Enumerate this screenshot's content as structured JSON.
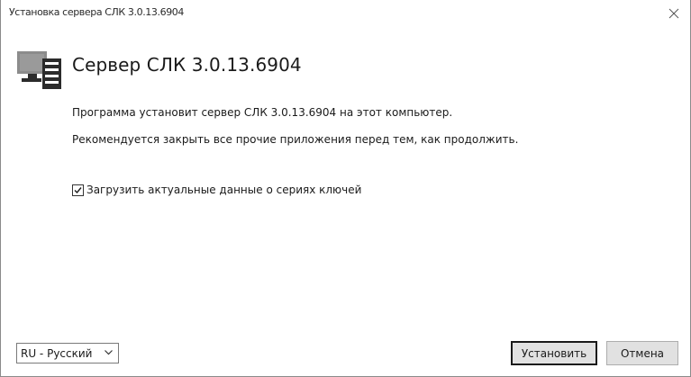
{
  "window": {
    "title": "Установка сервера СЛК 3.0.13.6904"
  },
  "header": {
    "title": "Сервер СЛК 3.0.13.6904",
    "icon": "server-computer-icon"
  },
  "body": {
    "line1": "Программа установит сервер СЛК 3.0.13.6904 на этот компьютер.",
    "line2": "Рекомендуется закрыть все прочие приложения перед тем, как продолжить."
  },
  "options": {
    "download_key_series": {
      "label": "Загрузить актуальные данные о сериях ключей",
      "checked": true
    }
  },
  "footer": {
    "language": {
      "selected": "RU - Русский"
    },
    "install_label": "Установить",
    "cancel_label": "Отмена"
  },
  "colors": {
    "button_face": "#e1e1e1",
    "button_border": "#adadad",
    "icon_dark": "#2b2b2b",
    "icon_light": "#8c8c8c"
  }
}
